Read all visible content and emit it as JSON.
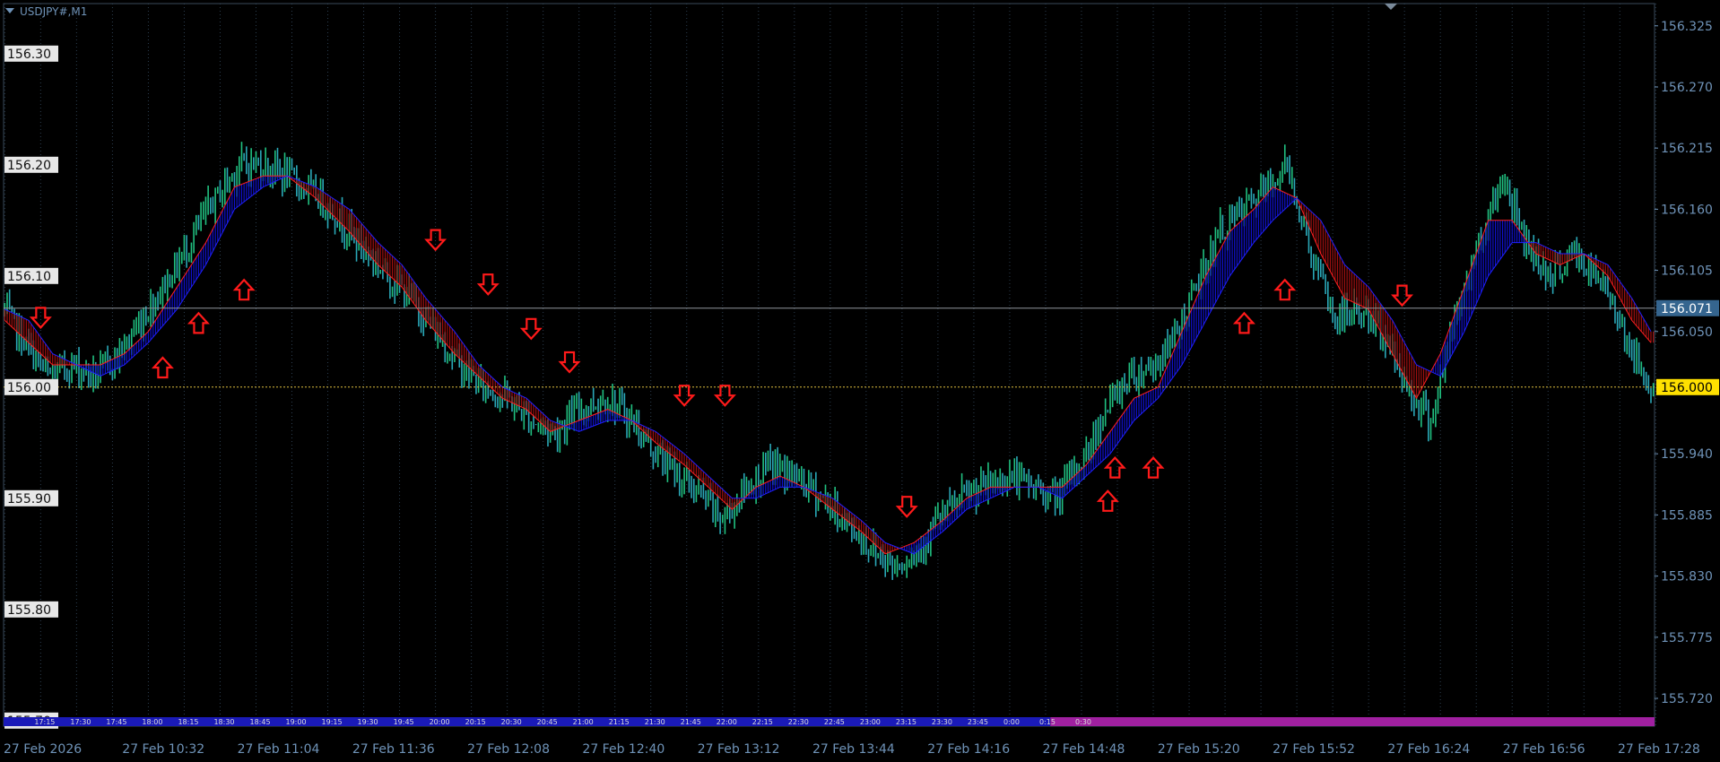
{
  "symbol": "USDJPY#,M1",
  "colors": {
    "background": "#000000",
    "grid": "#2c3e50",
    "axis": "#6f93b8",
    "bull": "#20c080",
    "bear": "#2aa8b8",
    "band_up": "#1010d0",
    "band_down": "#a01010",
    "arrow": "#ff1a1a",
    "bid_line": "#8f969c",
    "bid_label_bg": "#35658f",
    "ask_line": "#e0c040",
    "ask_label_bg": "#ffe000",
    "session_blue": "#1a1ab8",
    "session_magenta": "#a020a0"
  },
  "chart_data": {
    "type": "line",
    "price_axis_labels": [
      "156.325",
      "156.270",
      "156.215",
      "156.160",
      "156.105",
      "156.050",
      "155.940",
      "155.885",
      "155.830",
      "155.775",
      "155.720"
    ],
    "price_axis_values": [
      156.325,
      156.27,
      156.215,
      156.16,
      156.105,
      156.05,
      155.94,
      155.885,
      155.83,
      155.775,
      155.72
    ],
    "left_axis_labels": [
      "156.30",
      "156.20",
      "156.10",
      "156.00",
      "155.90",
      "155.80",
      "155.70"
    ],
    "left_axis_values": [
      156.3,
      156.2,
      156.1,
      156.0,
      155.9,
      155.8,
      155.7
    ],
    "time_axis_labels": [
      "27 Feb 2026",
      "27 Feb 10:32",
      "27 Feb 11:04",
      "27 Feb 11:36",
      "27 Feb 12:08",
      "27 Feb 12:40",
      "27 Feb 13:12",
      "27 Feb 13:44",
      "27 Feb 14:16",
      "27 Feb 14:48",
      "27 Feb 15:20",
      "27 Feb 15:52",
      "27 Feb 16:24",
      "27 Feb 16:56",
      "27 Feb 17:28"
    ],
    "session_labels": [
      "17:15",
      "17:30",
      "17:45",
      "18:00",
      "18:15",
      "18:30",
      "18:45",
      "19:00",
      "19:15",
      "19:30",
      "19:45",
      "20:00",
      "20:15",
      "20:30",
      "20:45",
      "21:00",
      "21:15",
      "21:30",
      "21:45",
      "22:00",
      "22:15",
      "22:30",
      "22:45",
      "23:00",
      "23:15",
      "23:30",
      "23:45",
      "0:00",
      "0:15",
      "0:30"
    ],
    "current_bid": 156.071,
    "current_bid_label": "156.071",
    "ask_line": 156.0,
    "ask_line_label": "156.000",
    "ylim": [
      155.695,
      156.345
    ],
    "close_path": [
      [
        0,
        156.07
      ],
      [
        8,
        156.04
      ],
      [
        18,
        156.01
      ],
      [
        28,
        156.02
      ],
      [
        38,
        156.01
      ],
      [
        48,
        156.03
      ],
      [
        60,
        156.07
      ],
      [
        72,
        156.11
      ],
      [
        85,
        156.16
      ],
      [
        98,
        156.2
      ],
      [
        108,
        156.2
      ],
      [
        118,
        156.19
      ],
      [
        132,
        156.17
      ],
      [
        148,
        156.13
      ],
      [
        160,
        156.1
      ],
      [
        170,
        156.08
      ],
      [
        180,
        156.05
      ],
      [
        190,
        156.02
      ],
      [
        200,
        156.0
      ],
      [
        210,
        155.99
      ],
      [
        220,
        155.97
      ],
      [
        230,
        155.96
      ],
      [
        240,
        155.98
      ],
      [
        252,
        155.99
      ],
      [
        262,
        155.97
      ],
      [
        272,
        155.94
      ],
      [
        282,
        155.92
      ],
      [
        292,
        155.9
      ],
      [
        300,
        155.88
      ],
      [
        310,
        155.91
      ],
      [
        320,
        155.93
      ],
      [
        330,
        155.92
      ],
      [
        342,
        155.9
      ],
      [
        355,
        155.87
      ],
      [
        365,
        155.85
      ],
      [
        372,
        155.84
      ],
      [
        380,
        155.85
      ],
      [
        390,
        155.88
      ],
      [
        400,
        155.9
      ],
      [
        410,
        155.91
      ],
      [
        420,
        155.92
      ],
      [
        430,
        155.91
      ],
      [
        440,
        155.9
      ],
      [
        452,
        155.94
      ],
      [
        460,
        155.98
      ],
      [
        470,
        156.01
      ],
      [
        480,
        156.02
      ],
      [
        488,
        156.04
      ],
      [
        498,
        156.09
      ],
      [
        508,
        156.14
      ],
      [
        518,
        156.16
      ],
      [
        528,
        156.18
      ],
      [
        536,
        156.2
      ],
      [
        546,
        156.12
      ],
      [
        556,
        156.06
      ],
      [
        566,
        156.07
      ],
      [
        576,
        156.05
      ],
      [
        586,
        156.0
      ],
      [
        596,
        155.97
      ],
      [
        606,
        156.06
      ],
      [
        616,
        156.13
      ],
      [
        626,
        156.19
      ],
      [
        636,
        156.13
      ],
      [
        646,
        156.1
      ],
      [
        656,
        156.12
      ],
      [
        664,
        156.1
      ],
      [
        672,
        156.08
      ],
      [
        680,
        156.03
      ],
      [
        688,
        156.0
      ]
    ],
    "band_fast": [
      [
        0,
        156.06
      ],
      [
        10,
        156.04
      ],
      [
        20,
        156.02
      ],
      [
        30,
        156.02
      ],
      [
        40,
        156.02
      ],
      [
        50,
        156.03
      ],
      [
        60,
        156.05
      ],
      [
        72,
        156.09
      ],
      [
        84,
        156.13
      ],
      [
        96,
        156.18
      ],
      [
        108,
        156.19
      ],
      [
        118,
        156.19
      ],
      [
        130,
        156.17
      ],
      [
        144,
        156.14
      ],
      [
        156,
        156.11
      ],
      [
        166,
        156.09
      ],
      [
        176,
        156.06
      ],
      [
        188,
        156.03
      ],
      [
        198,
        156.01
      ],
      [
        208,
        155.99
      ],
      [
        218,
        155.98
      ],
      [
        228,
        155.96
      ],
      [
        240,
        155.97
      ],
      [
        252,
        155.98
      ],
      [
        262,
        155.97
      ],
      [
        272,
        155.95
      ],
      [
        284,
        155.93
      ],
      [
        294,
        155.91
      ],
      [
        304,
        155.89
      ],
      [
        314,
        155.91
      ],
      [
        324,
        155.92
      ],
      [
        334,
        155.91
      ],
      [
        346,
        155.89
      ],
      [
        358,
        155.87
      ],
      [
        368,
        155.85
      ],
      [
        380,
        155.86
      ],
      [
        392,
        155.88
      ],
      [
        402,
        155.9
      ],
      [
        412,
        155.91
      ],
      [
        422,
        155.91
      ],
      [
        432,
        155.91
      ],
      [
        442,
        155.91
      ],
      [
        452,
        155.93
      ],
      [
        462,
        155.96
      ],
      [
        472,
        155.99
      ],
      [
        482,
        156.0
      ],
      [
        492,
        156.05
      ],
      [
        502,
        156.1
      ],
      [
        512,
        156.14
      ],
      [
        522,
        156.16
      ],
      [
        530,
        156.18
      ],
      [
        540,
        156.17
      ],
      [
        550,
        156.12
      ],
      [
        560,
        156.08
      ],
      [
        570,
        156.07
      ],
      [
        580,
        156.03
      ],
      [
        590,
        155.99
      ],
      [
        600,
        156.03
      ],
      [
        610,
        156.09
      ],
      [
        620,
        156.15
      ],
      [
        630,
        156.15
      ],
      [
        640,
        156.12
      ],
      [
        650,
        156.11
      ],
      [
        660,
        156.12
      ],
      [
        670,
        156.1
      ],
      [
        680,
        156.06
      ],
      [
        688,
        156.04
      ]
    ],
    "band_slow": [
      [
        0,
        156.07
      ],
      [
        10,
        156.06
      ],
      [
        20,
        156.03
      ],
      [
        30,
        156.02
      ],
      [
        40,
        156.01
      ],
      [
        50,
        156.02
      ],
      [
        60,
        156.04
      ],
      [
        72,
        156.07
      ],
      [
        84,
        156.11
      ],
      [
        96,
        156.16
      ],
      [
        108,
        156.18
      ],
      [
        118,
        156.19
      ],
      [
        130,
        156.18
      ],
      [
        144,
        156.16
      ],
      [
        156,
        156.13
      ],
      [
        166,
        156.11
      ],
      [
        176,
        156.08
      ],
      [
        188,
        156.05
      ],
      [
        198,
        156.02
      ],
      [
        208,
        156.0
      ],
      [
        218,
        155.99
      ],
      [
        228,
        155.97
      ],
      [
        240,
        155.96
      ],
      [
        252,
        155.97
      ],
      [
        262,
        155.97
      ],
      [
        272,
        155.96
      ],
      [
        284,
        155.94
      ],
      [
        294,
        155.92
      ],
      [
        304,
        155.9
      ],
      [
        314,
        155.9
      ],
      [
        324,
        155.91
      ],
      [
        334,
        155.91
      ],
      [
        346,
        155.9
      ],
      [
        358,
        155.88
      ],
      [
        368,
        155.86
      ],
      [
        380,
        155.85
      ],
      [
        392,
        155.87
      ],
      [
        402,
        155.89
      ],
      [
        412,
        155.9
      ],
      [
        422,
        155.91
      ],
      [
        432,
        155.91
      ],
      [
        442,
        155.9
      ],
      [
        452,
        155.92
      ],
      [
        462,
        155.94
      ],
      [
        472,
        155.97
      ],
      [
        482,
        155.99
      ],
      [
        492,
        156.02
      ],
      [
        502,
        156.06
      ],
      [
        512,
        156.1
      ],
      [
        522,
        156.13
      ],
      [
        530,
        156.15
      ],
      [
        540,
        156.17
      ],
      [
        550,
        156.15
      ],
      [
        560,
        156.11
      ],
      [
        570,
        156.09
      ],
      [
        580,
        156.06
      ],
      [
        590,
        156.02
      ],
      [
        600,
        156.01
      ],
      [
        610,
        156.05
      ],
      [
        620,
        156.1
      ],
      [
        630,
        156.13
      ],
      [
        640,
        156.13
      ],
      [
        650,
        156.12
      ],
      [
        660,
        156.12
      ],
      [
        670,
        156.11
      ],
      [
        680,
        156.08
      ],
      [
        688,
        156.05
      ]
    ],
    "arrows": [
      {
        "dir": "down",
        "x": 15,
        "y": 156.06
      },
      {
        "dir": "up",
        "x": 66,
        "y": 156.02
      },
      {
        "dir": "up",
        "x": 81,
        "y": 156.06
      },
      {
        "dir": "up",
        "x": 100,
        "y": 156.09
      },
      {
        "dir": "down",
        "x": 180,
        "y": 156.13
      },
      {
        "dir": "down",
        "x": 202,
        "y": 156.09
      },
      {
        "dir": "down",
        "x": 220,
        "y": 156.05
      },
      {
        "dir": "down",
        "x": 236,
        "y": 156.02
      },
      {
        "dir": "down",
        "x": 284,
        "y": 155.99
      },
      {
        "dir": "down",
        "x": 301,
        "y": 155.99
      },
      {
        "dir": "down",
        "x": 377,
        "y": 155.89
      },
      {
        "dir": "up",
        "x": 461,
        "y": 155.9
      },
      {
        "dir": "up",
        "x": 464,
        "y": 155.93
      },
      {
        "dir": "up",
        "x": 480,
        "y": 155.93
      },
      {
        "dir": "up",
        "x": 518,
        "y": 156.06
      },
      {
        "dir": "up",
        "x": 535,
        "y": 156.09
      },
      {
        "dir": "down",
        "x": 584,
        "y": 156.08
      }
    ]
  }
}
